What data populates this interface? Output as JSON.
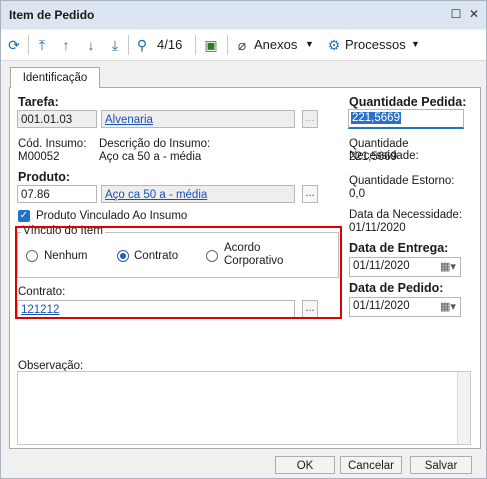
{
  "window": {
    "title": "Item de Pedido"
  },
  "toolbar": {
    "record_counter": "4/16",
    "anexos_label": "Anexos",
    "processos_label": "Processos"
  },
  "tab": {
    "label": "Identificação"
  },
  "form": {
    "tarefa_label": "Tarefa:",
    "tarefa_code": "001.01.03",
    "tarefa_desc": "Alvenaria",
    "cod_insumo_label": "Cód. Insumo:",
    "cod_insumo_value": "M00052",
    "desc_insumo_label": "Descrição do Insumo:",
    "desc_insumo_value": "Aço ca 50 a - média",
    "produto_label": "Produto:",
    "produto_code": "07.86",
    "produto_desc": "Aço ca 50 a - média",
    "vinculado_label": "Produto Vinculado Ao Insumo",
    "vinculo_group_label": "Vínculo do Item",
    "radio_nenhum": "Nenhum",
    "radio_contrato": "Contrato",
    "radio_acordo_line1": "Acordo",
    "radio_acordo_line2": "Corporativo",
    "contrato_label": "Contrato:",
    "contrato_value": "121212",
    "observacao_label": "Observação:"
  },
  "right": {
    "qtd_pedida_label": "Quantidade Pedida:",
    "qtd_pedida_value": "221,5669",
    "qtd_necessidade_label": "Quantidade Necessidade:",
    "qtd_necessidade_value": "221,5669",
    "qtd_estorno_label": "Quantidade Estorno:",
    "qtd_estorno_value": "0,0",
    "data_necessidade_label": "Data da Necessidade:",
    "data_necessidade_value": "01/11/2020",
    "data_entrega_label": "Data de Entrega:",
    "data_entrega_value": "01/11/2020",
    "data_pedido_label": "Data de Pedido:",
    "data_pedido_value": "01/11/2020"
  },
  "footer": {
    "ok_label": "OK",
    "cancel_label": "Cancelar",
    "save_label": "Salvar"
  },
  "colors": {
    "accent": "#1f74c8",
    "highlight": "#e00000",
    "titlebar": "#dce6f0"
  }
}
